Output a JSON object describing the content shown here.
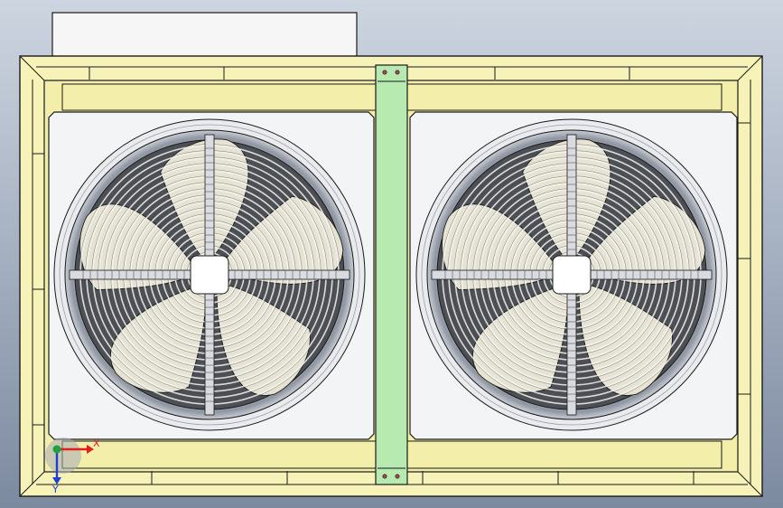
{
  "colors": {
    "background_top": "#cdd5e0",
    "background_bottom": "#7c8aa0",
    "frame_fill": "#f7f3b8",
    "frame_inner": "#f3eeaa",
    "outline": "#1a1a1a",
    "panel": "#f3f4f6",
    "tab_panel": "#f6f6f6",
    "bracket": "#b6eab0",
    "bracket_bolt": "#b23a5a",
    "ring_outer": "#e9ebef",
    "shroud": "#c7ccd4",
    "blade_light": "#e6e3d2",
    "blade_dark": "#4c5054",
    "guard_wire": "#f5f5f5",
    "hub": "#ffffff",
    "axis_x": "#e02020",
    "axis_y": "#2040d0",
    "axis_z": "#20a040"
  },
  "fans": [
    {
      "name": "left-fan"
    },
    {
      "name": "right-fan"
    }
  ],
  "axis": {
    "x_label": "X",
    "y_label": "Y"
  }
}
